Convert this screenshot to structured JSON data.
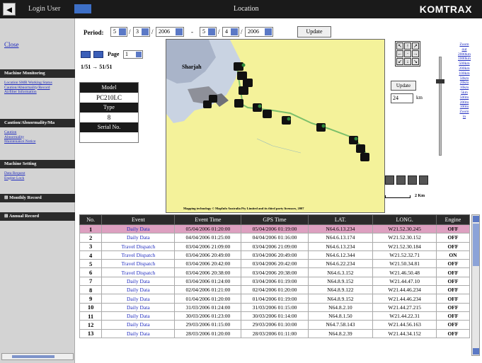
{
  "topbar": {
    "back_icon": "◄",
    "login_label": "Login User",
    "page_heading": "Location",
    "brand": "KOMTRAX"
  },
  "sidebar": {
    "close_label": "Close",
    "sections": [
      {
        "title": "Machine Monitoring",
        "links": [
          "Location SMR Working Status",
          "Caution/Abnormality/Record",
          "Airfilter Information"
        ]
      },
      {
        "title": "Caution/Abnormality/Ma",
        "links": [
          "Caution",
          "Abnormality",
          "Maintenance Notice"
        ]
      },
      {
        "title": "Machine Setting",
        "links": [
          "Data Request",
          "Engine Lock"
        ]
      },
      {
        "title": "Monthly Record",
        "links": []
      },
      {
        "title": "Annual Record",
        "links": []
      }
    ]
  },
  "period": {
    "label": "Period:",
    "from_day": "5",
    "from_month": "3",
    "from_year": "2006",
    "dash": "-",
    "to_day": "5",
    "to_month": "4",
    "to_year": "2006",
    "slash": "/",
    "update_label": "Update"
  },
  "pager": {
    "page_label": "Page",
    "page_value": "1",
    "range_text": "1/51 → 51/51"
  },
  "info": {
    "model_label": "Model",
    "model_value": "PC210LC",
    "type_label": "Type",
    "type_value": "8",
    "serial_label": "Serial No.",
    "serial_value": ""
  },
  "map": {
    "place_label": "Sharjah",
    "caption": "Mapping technology © MapInfo Australia Pty Limited and its third party licensors, 2007"
  },
  "map_controls": {
    "update_label": "Update",
    "radius_value": "24",
    "km_label": "km",
    "zoom_levels": [
      "Zoom",
      "out",
      "2000km",
      "1000km",
      "500km",
      "200km",
      "100km",
      "50km",
      "20km",
      "10km",
      "5km",
      "500m",
      "200m",
      "100m",
      "Zoom",
      "in"
    ],
    "scale_label": "2 Km"
  },
  "table": {
    "headers": [
      "No.",
      "Event",
      "Event Time",
      "GPS Time",
      "LAT.",
      "LONG.",
      "Engine"
    ],
    "rows": [
      [
        "1",
        "Daily Data",
        "05/04/2006 01:20:00",
        "05/04/2006 01:19:00",
        "N64.6.13.234",
        "W21.52.30.245",
        "OFF"
      ],
      [
        "2",
        "Daily Data",
        "04/04/2006 01:25:00",
        "04/04/2006 01:16:00",
        "N64.6.13.174",
        "W21.52.30.152",
        "OFF"
      ],
      [
        "3",
        "Travel Dispatch",
        "03/04/2006 21:09:00",
        "03/04/2006 21:09:00",
        "N64.6.13.234",
        "W21.52.30.184",
        "OFF"
      ],
      [
        "4",
        "Travel Dispatch",
        "03/04/2006 20:49:00",
        "03/04/2006 20:49:00",
        "N64.6.12.344",
        "W21.52.32.71",
        "ON"
      ],
      [
        "5",
        "Travel Dispatch",
        "03/04/2006 20:42:00",
        "03/04/2006 20:42:00",
        "N64.6.22.234",
        "W21.50.34.81",
        "OFF"
      ],
      [
        "6",
        "Travel Dispatch",
        "03/04/2006 20:38:00",
        "03/04/2006 20:38:00",
        "N64.6.3.152",
        "W21.46.50.48",
        "OFF"
      ],
      [
        "7",
        "Daily Data",
        "03/04/2006 01:24:00",
        "03/04/2006 01:19:00",
        "N64.8.9.152",
        "W21.44.47.10",
        "OFF"
      ],
      [
        "8",
        "Daily Data",
        "02/04/2006 01:21:00",
        "02/04/2006 01:20:00",
        "N64.8.9.122",
        "W21.44.46.234",
        "OFF"
      ],
      [
        "9",
        "Daily Data",
        "01/04/2006 01:20:00",
        "01/04/2006 01:19:00",
        "N64.8.9.152",
        "W21.44.46.234",
        "OFF"
      ],
      [
        "10",
        "Daily Data",
        "31/03/2006 01:24:00",
        "31/03/2006 01:15:00",
        "N64.8.2.10",
        "W21.44.27.215",
        "OFF"
      ],
      [
        "11",
        "Daily Data",
        "30/03/2006 01:23:00",
        "30/03/2006 01:14:00",
        "N64.8.1.50",
        "W21.44.22.31",
        "OFF"
      ],
      [
        "12",
        "Daily Data",
        "29/03/2006 01:15:00",
        "29/03/2006 01:10:00",
        "N64.7.58.143",
        "W21.44.56.163",
        "OFF"
      ],
      [
        "13",
        "Daily Data",
        "28/03/2006 01:20:00",
        "28/03/2006 01:11:00",
        "N64.8.2.39",
        "W21.44.34.152",
        "OFF"
      ]
    ]
  }
}
